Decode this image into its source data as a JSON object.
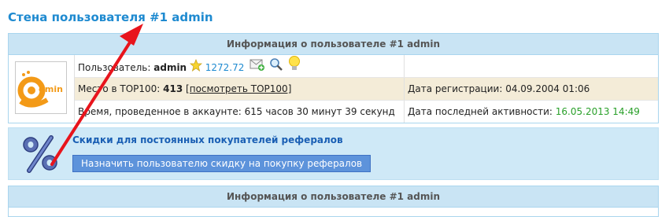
{
  "page": {
    "title": "Стена пользователя #1 admin"
  },
  "info_panel": {
    "header": "Информация о пользователе #1 admin",
    "avatar_alt": "admin",
    "user_label": "Пользователь:",
    "username": "admin",
    "rating": "1272.72",
    "place_label": "Место в TOP100:",
    "place_value": "413",
    "top100_link": "[посмотреть TOP100]",
    "time_label": "Время, проведенное в аккаунте:",
    "time_value": "615 часов 30 минут 39 секунд",
    "reg_label": "Дата регистрации:",
    "reg_value": "04.09.2004 01:06",
    "last_label": "Дата последней активности:",
    "last_value": "16.05.2013 14:49"
  },
  "discount_panel": {
    "title": "Скидки для постоянных покупателей рефералов",
    "button": "Назначить пользователю скидку на покупку рефералов"
  },
  "info_panel2": {
    "header": "Информация о пользователе #1 admin"
  },
  "colors": {
    "title": "#1e8ad0",
    "header_bg": "#c9e4f4",
    "highlight_row": "#f4ecd8",
    "arrow": "#e8141c",
    "button_bg": "#5d93db"
  },
  "icons": [
    "star-icon",
    "add-mail-icon",
    "magnifier-icon",
    "lightbulb-icon",
    "percent-icon",
    "red-annotation-arrow"
  ]
}
